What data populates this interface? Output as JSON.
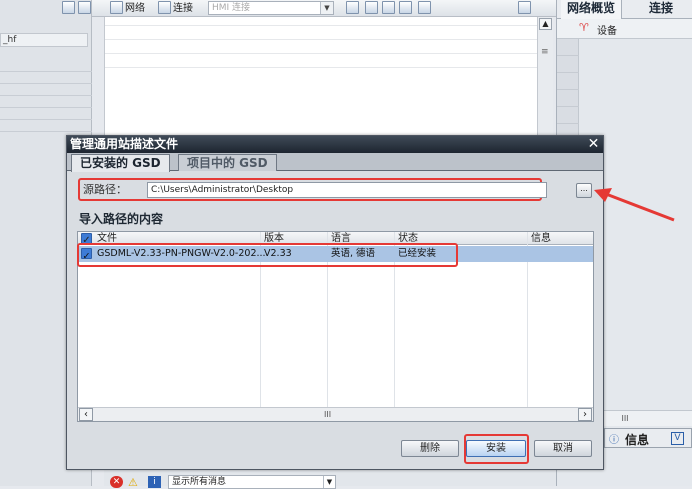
{
  "left_pane": {
    "item": "_hf"
  },
  "toolbar": {
    "network": "网络",
    "connection": "连接",
    "hmi_connection": "HMI 连接"
  },
  "right_panel": {
    "tab_network_overview": "网络概览",
    "tab_connection": "连接",
    "device_header": "设备",
    "scroll_marker": "III",
    "info_tab": "信息"
  },
  "dialog": {
    "title": "管理通用站描述文件",
    "tabs": [
      {
        "label": "已安装的 GSD"
      },
      {
        "label": "项目中的 GSD"
      }
    ],
    "source_path_label": "源路径：",
    "source_path_value": "C:\\Users\\Administrator\\Desktop",
    "browse_label": "...",
    "section_title": "导入路径的内容",
    "columns": [
      "文件",
      "版本",
      "语言",
      "状态",
      "信息"
    ],
    "rows": [
      {
        "file": "GSDML-V2.33-PN-PNGW-V2.0-202...",
        "version": "V2.33",
        "language": "英语, 德语",
        "status": "已经安装",
        "info": ""
      }
    ],
    "hscroll_marker": "III",
    "buttons": {
      "delete": "删除",
      "install": "安装",
      "cancel": "取消"
    }
  },
  "bottom_bar": {
    "filter": "显示所有消息"
  },
  "colors": {
    "highlight": "#e53935",
    "selection": "#aac4e4",
    "title_bar": "#1d2530"
  }
}
